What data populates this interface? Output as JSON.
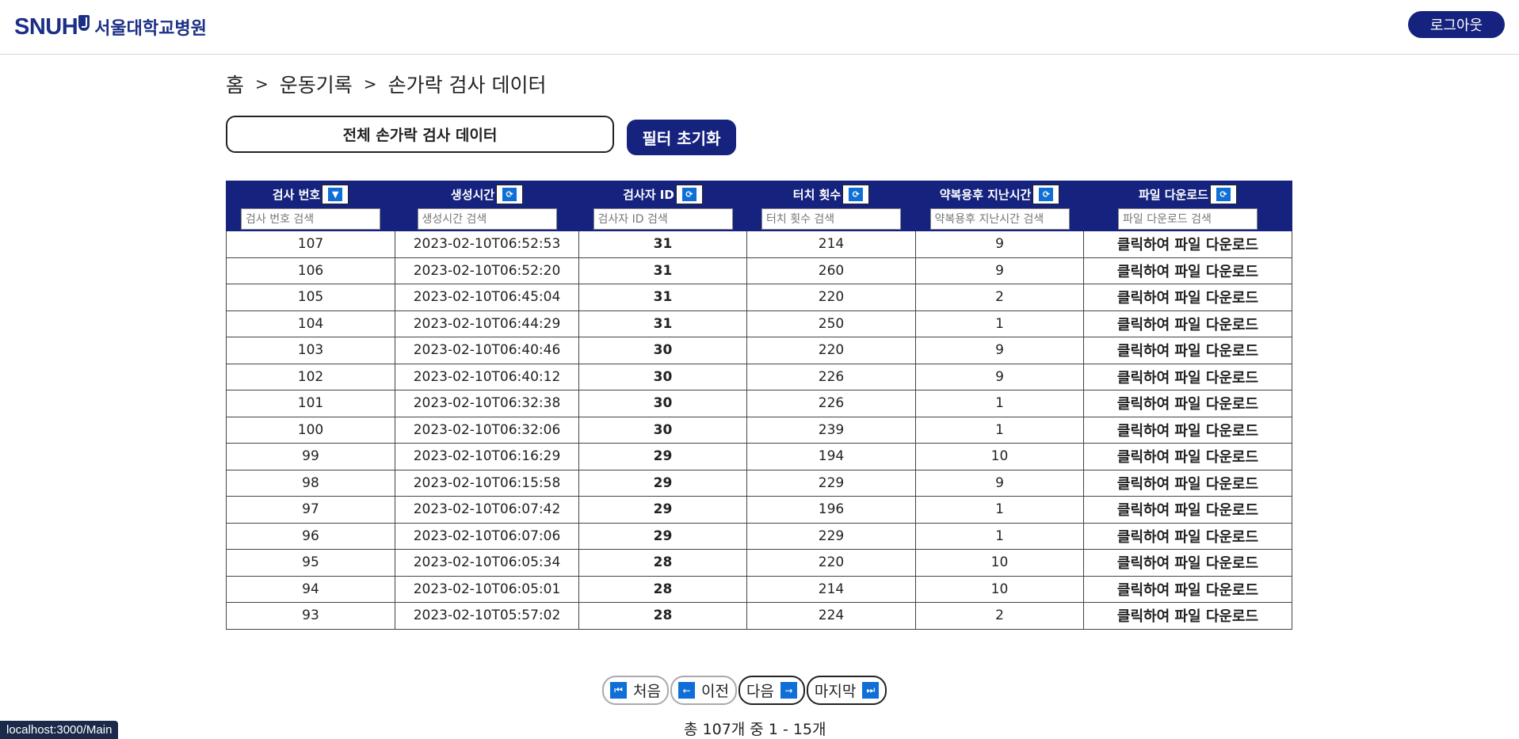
{
  "header": {
    "logo_text": "SNUH",
    "logo_korean": "서울대학교병원",
    "logout_label": "로그아웃"
  },
  "breadcrumb": [
    "홈",
    "운동기록",
    "손가락 검사 데이터"
  ],
  "breadcrumb_separator": ">",
  "title": "전체 손가락 검사 데이터",
  "reset_label": "필터 초기화",
  "table": {
    "columns": [
      {
        "label": "검사 번호",
        "placeholder": "검사 번호 검색",
        "sort_icon": "sort-desc-icon"
      },
      {
        "label": "생성시간",
        "placeholder": "생성시간 검색",
        "sort_icon": "refresh-icon"
      },
      {
        "label": "검사자 ID",
        "placeholder": "검사자 ID 검색",
        "sort_icon": "refresh-icon"
      },
      {
        "label": "터치 횟수",
        "placeholder": "터치 횟수 검색",
        "sort_icon": "refresh-icon"
      },
      {
        "label": "약복용후 지난시간",
        "placeholder": "약복용후 지난시간 검색",
        "sort_icon": "refresh-icon"
      },
      {
        "label": "파일 다운로드",
        "placeholder": "파일 다운로드 검색",
        "sort_icon": "refresh-icon"
      }
    ],
    "rows": [
      [
        "107",
        "2023-02-10T06:52:53",
        "31",
        "214",
        "9",
        "클릭하여 파일 다운로드"
      ],
      [
        "106",
        "2023-02-10T06:52:20",
        "31",
        "260",
        "9",
        "클릭하여 파일 다운로드"
      ],
      [
        "105",
        "2023-02-10T06:45:04",
        "31",
        "220",
        "2",
        "클릭하여 파일 다운로드"
      ],
      [
        "104",
        "2023-02-10T06:44:29",
        "31",
        "250",
        "1",
        "클릭하여 파일 다운로드"
      ],
      [
        "103",
        "2023-02-10T06:40:46",
        "30",
        "220",
        "9",
        "클릭하여 파일 다운로드"
      ],
      [
        "102",
        "2023-02-10T06:40:12",
        "30",
        "226",
        "9",
        "클릭하여 파일 다운로드"
      ],
      [
        "101",
        "2023-02-10T06:32:38",
        "30",
        "226",
        "1",
        "클릭하여 파일 다운로드"
      ],
      [
        "100",
        "2023-02-10T06:32:06",
        "30",
        "239",
        "1",
        "클릭하여 파일 다운로드"
      ],
      [
        "99",
        "2023-02-10T06:16:29",
        "29",
        "194",
        "10",
        "클릭하여 파일 다운로드"
      ],
      [
        "98",
        "2023-02-10T06:15:58",
        "29",
        "229",
        "9",
        "클릭하여 파일 다운로드"
      ],
      [
        "97",
        "2023-02-10T06:07:42",
        "29",
        "196",
        "1",
        "클릭하여 파일 다운로드"
      ],
      [
        "96",
        "2023-02-10T06:07:06",
        "29",
        "229",
        "1",
        "클릭하여 파일 다운로드"
      ],
      [
        "95",
        "2023-02-10T06:05:34",
        "28",
        "220",
        "10",
        "클릭하여 파일 다운로드"
      ],
      [
        "94",
        "2023-02-10T06:05:01",
        "28",
        "214",
        "10",
        "클릭하여 파일 다운로드"
      ],
      [
        "93",
        "2023-02-10T05:57:02",
        "28",
        "224",
        "2",
        "클릭하여 파일 다운로드"
      ]
    ]
  },
  "pagination": {
    "first_label": "처음",
    "prev_label": "이전",
    "next_label": "다음",
    "last_label": "마지막",
    "summary": "총 107개 중 1 - 15개"
  },
  "status_url": "localhost:3000/Main",
  "colors": {
    "primary": "#15237e",
    "icon_blue": "#0f6fd6"
  }
}
